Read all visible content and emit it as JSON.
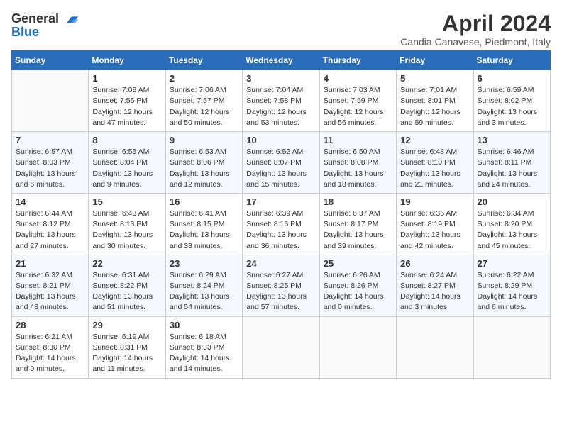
{
  "header": {
    "logo_line1": "General",
    "logo_line2": "Blue",
    "month_title": "April 2024",
    "subtitle": "Candia Canavese, Piedmont, Italy"
  },
  "columns": [
    "Sunday",
    "Monday",
    "Tuesday",
    "Wednesday",
    "Thursday",
    "Friday",
    "Saturday"
  ],
  "weeks": [
    [
      null,
      {
        "day": "1",
        "sunrise": "7:08 AM",
        "sunset": "7:55 PM",
        "daylight": "12 hours and 47 minutes."
      },
      {
        "day": "2",
        "sunrise": "7:06 AM",
        "sunset": "7:57 PM",
        "daylight": "12 hours and 50 minutes."
      },
      {
        "day": "3",
        "sunrise": "7:04 AM",
        "sunset": "7:58 PM",
        "daylight": "12 hours and 53 minutes."
      },
      {
        "day": "4",
        "sunrise": "7:03 AM",
        "sunset": "7:59 PM",
        "daylight": "12 hours and 56 minutes."
      },
      {
        "day": "5",
        "sunrise": "7:01 AM",
        "sunset": "8:01 PM",
        "daylight": "12 hours and 59 minutes."
      },
      {
        "day": "6",
        "sunrise": "6:59 AM",
        "sunset": "8:02 PM",
        "daylight": "13 hours and 3 minutes."
      }
    ],
    [
      {
        "day": "7",
        "sunrise": "6:57 AM",
        "sunset": "8:03 PM",
        "daylight": "13 hours and 6 minutes."
      },
      {
        "day": "8",
        "sunrise": "6:55 AM",
        "sunset": "8:04 PM",
        "daylight": "13 hours and 9 minutes."
      },
      {
        "day": "9",
        "sunrise": "6:53 AM",
        "sunset": "8:06 PM",
        "daylight": "13 hours and 12 minutes."
      },
      {
        "day": "10",
        "sunrise": "6:52 AM",
        "sunset": "8:07 PM",
        "daylight": "13 hours and 15 minutes."
      },
      {
        "day": "11",
        "sunrise": "6:50 AM",
        "sunset": "8:08 PM",
        "daylight": "13 hours and 18 minutes."
      },
      {
        "day": "12",
        "sunrise": "6:48 AM",
        "sunset": "8:10 PM",
        "daylight": "13 hours and 21 minutes."
      },
      {
        "day": "13",
        "sunrise": "6:46 AM",
        "sunset": "8:11 PM",
        "daylight": "13 hours and 24 minutes."
      }
    ],
    [
      {
        "day": "14",
        "sunrise": "6:44 AM",
        "sunset": "8:12 PM",
        "daylight": "13 hours and 27 minutes."
      },
      {
        "day": "15",
        "sunrise": "6:43 AM",
        "sunset": "8:13 PM",
        "daylight": "13 hours and 30 minutes."
      },
      {
        "day": "16",
        "sunrise": "6:41 AM",
        "sunset": "8:15 PM",
        "daylight": "13 hours and 33 minutes."
      },
      {
        "day": "17",
        "sunrise": "6:39 AM",
        "sunset": "8:16 PM",
        "daylight": "13 hours and 36 minutes."
      },
      {
        "day": "18",
        "sunrise": "6:37 AM",
        "sunset": "8:17 PM",
        "daylight": "13 hours and 39 minutes."
      },
      {
        "day": "19",
        "sunrise": "6:36 AM",
        "sunset": "8:19 PM",
        "daylight": "13 hours and 42 minutes."
      },
      {
        "day": "20",
        "sunrise": "6:34 AM",
        "sunset": "8:20 PM",
        "daylight": "13 hours and 45 minutes."
      }
    ],
    [
      {
        "day": "21",
        "sunrise": "6:32 AM",
        "sunset": "8:21 PM",
        "daylight": "13 hours and 48 minutes."
      },
      {
        "day": "22",
        "sunrise": "6:31 AM",
        "sunset": "8:22 PM",
        "daylight": "13 hours and 51 minutes."
      },
      {
        "day": "23",
        "sunrise": "6:29 AM",
        "sunset": "8:24 PM",
        "daylight": "13 hours and 54 minutes."
      },
      {
        "day": "24",
        "sunrise": "6:27 AM",
        "sunset": "8:25 PM",
        "daylight": "13 hours and 57 minutes."
      },
      {
        "day": "25",
        "sunrise": "6:26 AM",
        "sunset": "8:26 PM",
        "daylight": "14 hours and 0 minutes."
      },
      {
        "day": "26",
        "sunrise": "6:24 AM",
        "sunset": "8:27 PM",
        "daylight": "14 hours and 3 minutes."
      },
      {
        "day": "27",
        "sunrise": "6:22 AM",
        "sunset": "8:29 PM",
        "daylight": "14 hours and 6 minutes."
      }
    ],
    [
      {
        "day": "28",
        "sunrise": "6:21 AM",
        "sunset": "8:30 PM",
        "daylight": "14 hours and 9 minutes."
      },
      {
        "day": "29",
        "sunrise": "6:19 AM",
        "sunset": "8:31 PM",
        "daylight": "14 hours and 11 minutes."
      },
      {
        "day": "30",
        "sunrise": "6:18 AM",
        "sunset": "8:33 PM",
        "daylight": "14 hours and 14 minutes."
      },
      null,
      null,
      null,
      null
    ]
  ],
  "labels": {
    "sunrise": "Sunrise:",
    "sunset": "Sunset:",
    "daylight": "Daylight:"
  }
}
